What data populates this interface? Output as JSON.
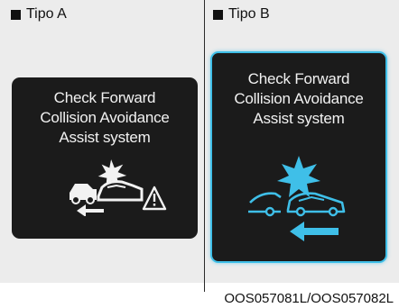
{
  "panels": [
    {
      "label": "Tipo A",
      "message_lines": [
        "Check Forward",
        "Collision Avoidance",
        "Assist system"
      ],
      "icon": "collision-warning-icon",
      "accent_color": "#ffffff"
    },
    {
      "label": "Tipo B",
      "message_lines": [
        "Check Forward",
        "Collision Avoidance",
        "Assist system"
      ],
      "icon": "collision-warning-icon",
      "accent_color": "#3fbfe8"
    }
  ],
  "caption": "OOS057081L/OOS057082L"
}
